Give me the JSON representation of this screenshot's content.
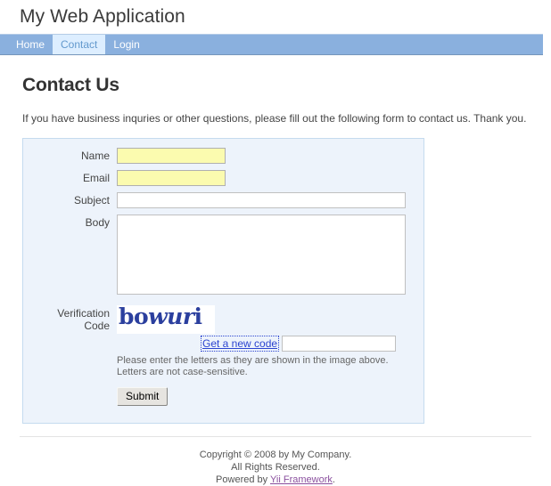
{
  "header": {
    "site_title": "My Web Application"
  },
  "mainmenu": {
    "items": [
      {
        "label": "Home",
        "active": false
      },
      {
        "label": "Contact",
        "active": true
      },
      {
        "label": "Login",
        "active": false
      }
    ]
  },
  "content": {
    "page_title": "Contact Us",
    "intro": "If you have business inquries or other questions, please fill out the following form to contact us. Thank you."
  },
  "form": {
    "fields": {
      "name": {
        "label": "Name",
        "value": "",
        "placeholder": ""
      },
      "email": {
        "label": "Email",
        "value": "",
        "placeholder": ""
      },
      "subject": {
        "label": "Subject",
        "value": "",
        "placeholder": ""
      },
      "body": {
        "label": "Body",
        "value": "",
        "placeholder": ""
      },
      "verification": {
        "label_line1": "Verification",
        "label_line2": "Code",
        "value": "",
        "placeholder": ""
      }
    },
    "captcha": {
      "code_text": "bowuri",
      "code_part1": "bo",
      "code_part2": "wur",
      "code_part3": "i",
      "refresh_link": "Get a new code",
      "hint_line1": "Please enter the letters as they are shown in the image above.",
      "hint_line2": "Letters are not case-sensitive."
    },
    "submit_label": "Submit"
  },
  "footer": {
    "copyright": "Copyright © 2008 by My Company.",
    "rights": "All Rights Reserved.",
    "powered_prefix": "Powered by ",
    "powered_link": "Yii Framework",
    "powered_suffix": "."
  },
  "colors": {
    "nav_bg": "#8ab0de",
    "nav_active_bg": "#ddeeff",
    "nav_active_text": "#6399cd",
    "form_bg": "#edf3fb",
    "form_border": "#c5dbef",
    "required_field_bg": "#fbfbaf",
    "link": "#2b44d0",
    "footer_link": "#8a4f9e",
    "captcha_text": "#2b3f9e"
  }
}
